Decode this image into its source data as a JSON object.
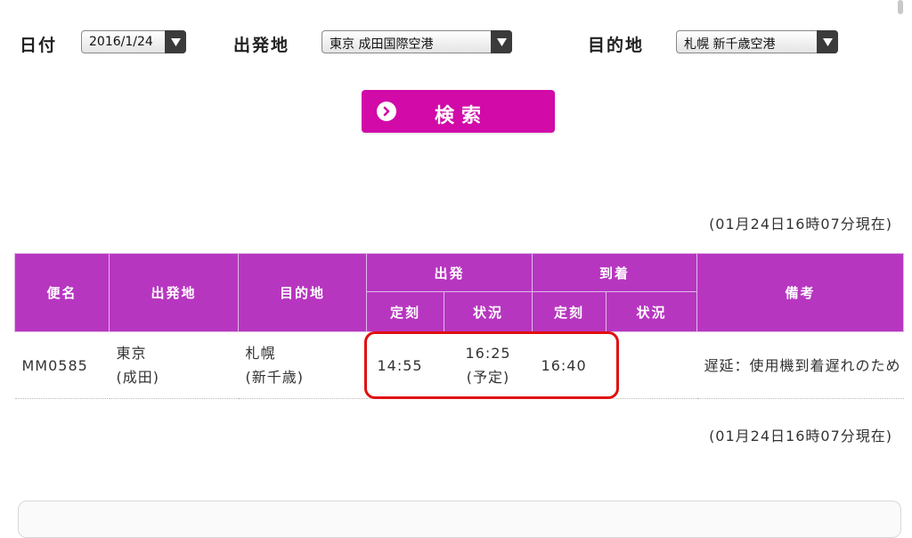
{
  "search_form": {
    "date_label": "日付",
    "date_value": "2016/1/24",
    "origin_label": "出発地",
    "origin_value": "東京 成田国際空港",
    "destination_label": "目的地",
    "destination_value": "札幌 新千歳空港",
    "search_button_label": "検索",
    "search_button_color": "#d10aa8",
    "dropdown_icon": "chevron-down-icon",
    "search_icon": "chevron-right-circle-icon"
  },
  "timestamp_text": "(01月24日16時07分現在)",
  "table": {
    "header_color": "#b736c0",
    "headers": {
      "flight": "便名",
      "origin": "出発地",
      "destination": "目的地",
      "departure": "出発",
      "arrival": "到着",
      "remarks": "備考",
      "scheduled": "定刻",
      "status": "状況"
    },
    "rows": [
      {
        "flight": "MM0585",
        "origin_city": "東京",
        "origin_airport": "(成田)",
        "destination_city": "札幌",
        "destination_airport": "(新千歳)",
        "departure_scheduled": "14:55",
        "departure_status_time": "16:25",
        "departure_status_note": "(予定)",
        "arrival_scheduled": "16:40",
        "arrival_status": "",
        "remarks": "遅延：使用機到着遅れのため"
      }
    ]
  },
  "highlight_color": "#e01010"
}
